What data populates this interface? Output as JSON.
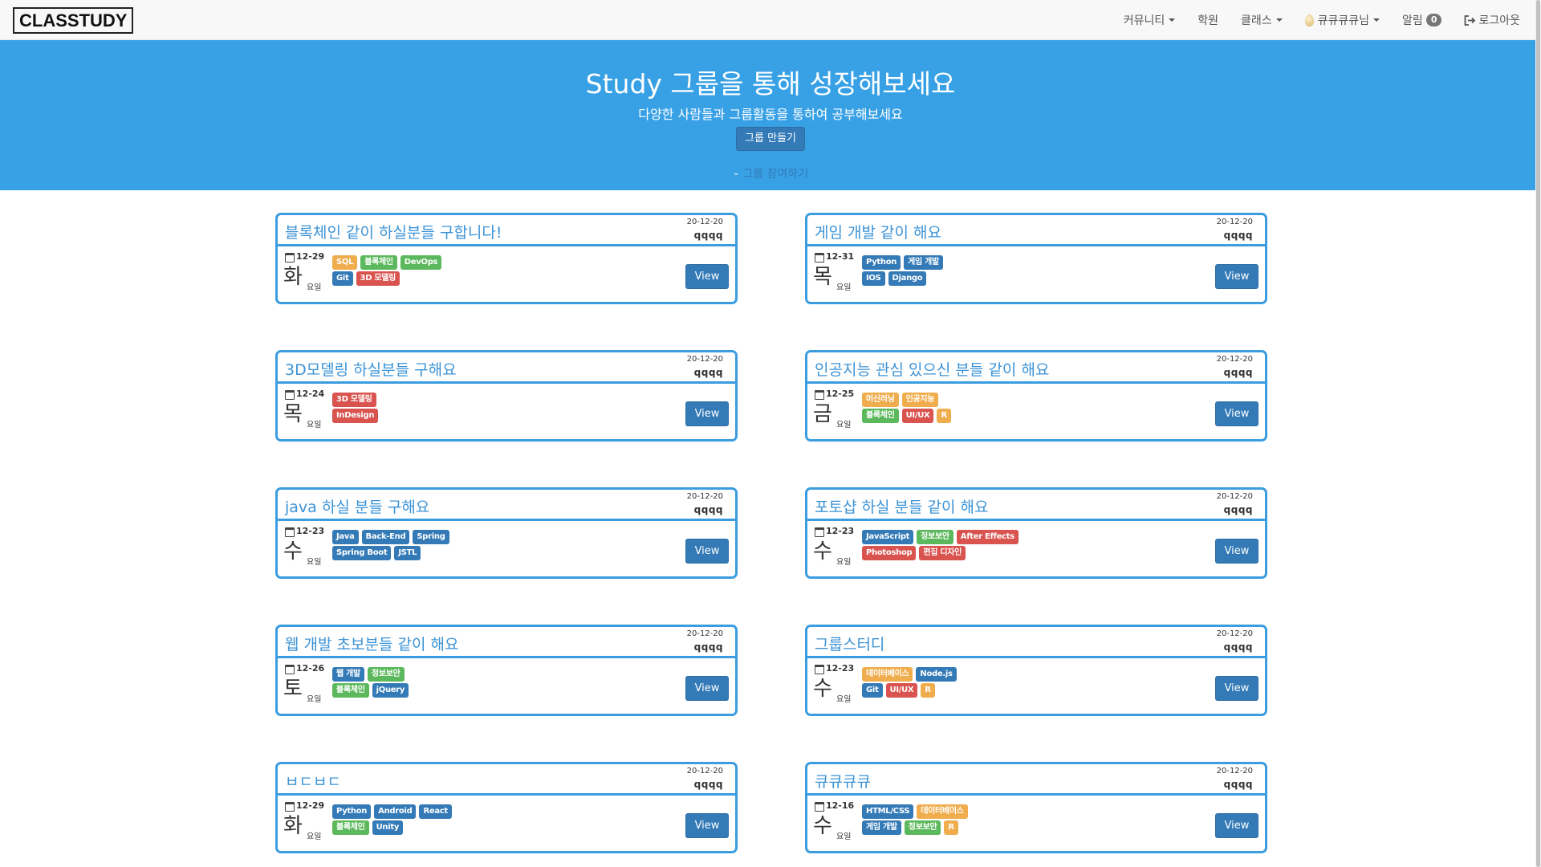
{
  "nav": {
    "logo": "CLASSTUDY",
    "community": "커뮤니티",
    "academy": "학원",
    "class": "클래스",
    "user": "큐큐큐큐님",
    "alarm": "알림",
    "alarm_count": "0",
    "logout": "로그아웃"
  },
  "hero": {
    "title": "Study 그룹을 통해 성장해보세요",
    "subtitle": "다양한 사람들과 그룹활동을 통하여 공부해보세요",
    "create_button": "그룹 만들기",
    "join_link": "그룹 참여하기"
  },
  "weekday_suffix": "요일",
  "view_label": "View",
  "colors": {
    "hero_bg": "#38a1e6",
    "card_border": "#3b9de0",
    "primary": "#337ab7",
    "green": "#5cb85c",
    "orange": "#f0ad4e",
    "red": "#d9534f"
  },
  "cards": [
    {
      "title": "블록체인 같이 하실분들 구합니다!",
      "date": "20-12-20",
      "author": "qqqq",
      "day": "12-29",
      "weekday": "화",
      "tag_rows": [
        [
          {
            "label": "SQL",
            "color": "orange"
          },
          {
            "label": "블록체인",
            "color": "green"
          },
          {
            "label": "DevOps",
            "color": "green"
          }
        ],
        [
          {
            "label": "Git",
            "color": "blue"
          },
          {
            "label": "3D 모델링",
            "color": "red"
          }
        ]
      ]
    },
    {
      "title": "게임 개발 같이 해요",
      "date": "20-12-20",
      "author": "qqqq",
      "day": "12-31",
      "weekday": "목",
      "tag_rows": [
        [
          {
            "label": "Python",
            "color": "blue"
          },
          {
            "label": "게임 개발",
            "color": "blue"
          }
        ],
        [
          {
            "label": "IOS",
            "color": "blue"
          },
          {
            "label": "Django",
            "color": "blue"
          }
        ]
      ]
    },
    {
      "title": "3D모델링 하실분들 구해요",
      "date": "20-12-20",
      "author": "qqqq",
      "day": "12-24",
      "weekday": "목",
      "tag_rows": [
        [
          {
            "label": "3D 모델링",
            "color": "red"
          }
        ],
        [
          {
            "label": "InDesign",
            "color": "red"
          }
        ]
      ]
    },
    {
      "title": "인공지능 관심 있으신 분들 같이 해요",
      "date": "20-12-20",
      "author": "qqqq",
      "day": "12-25",
      "weekday": "금",
      "tag_rows": [
        [
          {
            "label": "머신러닝",
            "color": "orange"
          },
          {
            "label": "인공지능",
            "color": "orange"
          }
        ],
        [
          {
            "label": "블록체인",
            "color": "green"
          },
          {
            "label": "UI/UX",
            "color": "red"
          },
          {
            "label": "R",
            "color": "orange"
          }
        ]
      ]
    },
    {
      "title": "java 하실 분들 구해요",
      "date": "20-12-20",
      "author": "qqqq",
      "day": "12-23",
      "weekday": "수",
      "tag_rows": [
        [
          {
            "label": "Java",
            "color": "blue"
          },
          {
            "label": "Back-End",
            "color": "blue"
          },
          {
            "label": "Spring",
            "color": "blue"
          }
        ],
        [
          {
            "label": "Spring Boot",
            "color": "blue"
          },
          {
            "label": "JSTL",
            "color": "blue"
          }
        ]
      ]
    },
    {
      "title": "포토샵 하실 분들 같이 해요",
      "date": "20-12-20",
      "author": "qqqq",
      "day": "12-23",
      "weekday": "수",
      "tag_rows": [
        [
          {
            "label": "JavaScript",
            "color": "blue"
          },
          {
            "label": "정보보안",
            "color": "green"
          },
          {
            "label": "After Effects",
            "color": "red"
          }
        ],
        [
          {
            "label": "Photoshop",
            "color": "red"
          },
          {
            "label": "편집 디자인",
            "color": "red"
          }
        ]
      ]
    },
    {
      "title": "웹 개발 초보분들 같이 해요",
      "date": "20-12-20",
      "author": "qqqq",
      "day": "12-26",
      "weekday": "토",
      "tag_rows": [
        [
          {
            "label": "웹 개발",
            "color": "blue"
          },
          {
            "label": "정보보안",
            "color": "green"
          }
        ],
        [
          {
            "label": "블록체인",
            "color": "green"
          },
          {
            "label": "jQuery",
            "color": "blue"
          }
        ]
      ]
    },
    {
      "title": "그룹스터디",
      "date": "20-12-20",
      "author": "qqqq",
      "day": "12-23",
      "weekday": "수",
      "tag_rows": [
        [
          {
            "label": "데이터베이스",
            "color": "orange"
          },
          {
            "label": "Node.js",
            "color": "blue"
          }
        ],
        [
          {
            "label": "Git",
            "color": "blue"
          },
          {
            "label": "UI/UX",
            "color": "red"
          },
          {
            "label": "R",
            "color": "orange"
          }
        ]
      ]
    },
    {
      "title": "ㅂㄷㅂㄷ",
      "date": "20-12-20",
      "author": "qqqq",
      "day": "12-29",
      "weekday": "화",
      "tag_rows": [
        [
          {
            "label": "Python",
            "color": "blue"
          },
          {
            "label": "Android",
            "color": "blue"
          },
          {
            "label": "React",
            "color": "blue"
          }
        ],
        [
          {
            "label": "블록체인",
            "color": "green"
          },
          {
            "label": "Unity",
            "color": "blue"
          }
        ]
      ]
    },
    {
      "title": "큐큐큐큐",
      "date": "20-12-20",
      "author": "qqqq",
      "day": "12-16",
      "weekday": "수",
      "tag_rows": [
        [
          {
            "label": "HTML/CSS",
            "color": "blue"
          },
          {
            "label": "데이터베이스",
            "color": "orange"
          }
        ],
        [
          {
            "label": "게임 개발",
            "color": "blue"
          },
          {
            "label": "정보보안",
            "color": "green"
          },
          {
            "label": "R",
            "color": "orange"
          }
        ]
      ]
    }
  ]
}
